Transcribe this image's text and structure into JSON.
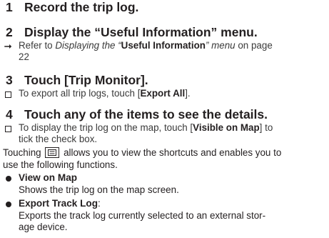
{
  "steps": [
    {
      "num": "1",
      "title": "Record the trip log."
    },
    {
      "num": "2",
      "title": "Display the “Useful Information” menu."
    },
    {
      "num": "3",
      "title": "Touch [Trip Monitor]."
    },
    {
      "num": "4",
      "title": "Touch any of the items to see the details."
    }
  ],
  "step2_ref": {
    "pre": "Refer to ",
    "italic_a": "Displaying the “",
    "bold": "Useful Information",
    "italic_b": "” menu",
    "post": " on page",
    "page": "22"
  },
  "step3_note": {
    "pre": "To export all trip logs, touch [",
    "bold": "Export All",
    "post": "]."
  },
  "step4_note": {
    "pre": "To display the trip log on the map, touch [",
    "bold": "Visible on Map",
    "post": "] to",
    "line2": "tick the check box."
  },
  "shortcuts_text": {
    "pre": "Touching",
    "post": "allows you to view the shortcuts and enables you to",
    "line2": "use the following functions."
  },
  "functions": [
    {
      "title": "View on Map",
      "desc": [
        "Shows the trip log on the map screen."
      ]
    },
    {
      "title": "Export Track Log",
      "suffix": ":",
      "desc": [
        "Exports the track log currently selected to an external stor-",
        "age device."
      ]
    }
  ],
  "icons": {
    "step2_marker": "arrow-right-icon",
    "note_marker": "square-checkbox-icon",
    "shortcut_button": "menu-list-icon",
    "bullet": "bullet-dot-icon"
  }
}
